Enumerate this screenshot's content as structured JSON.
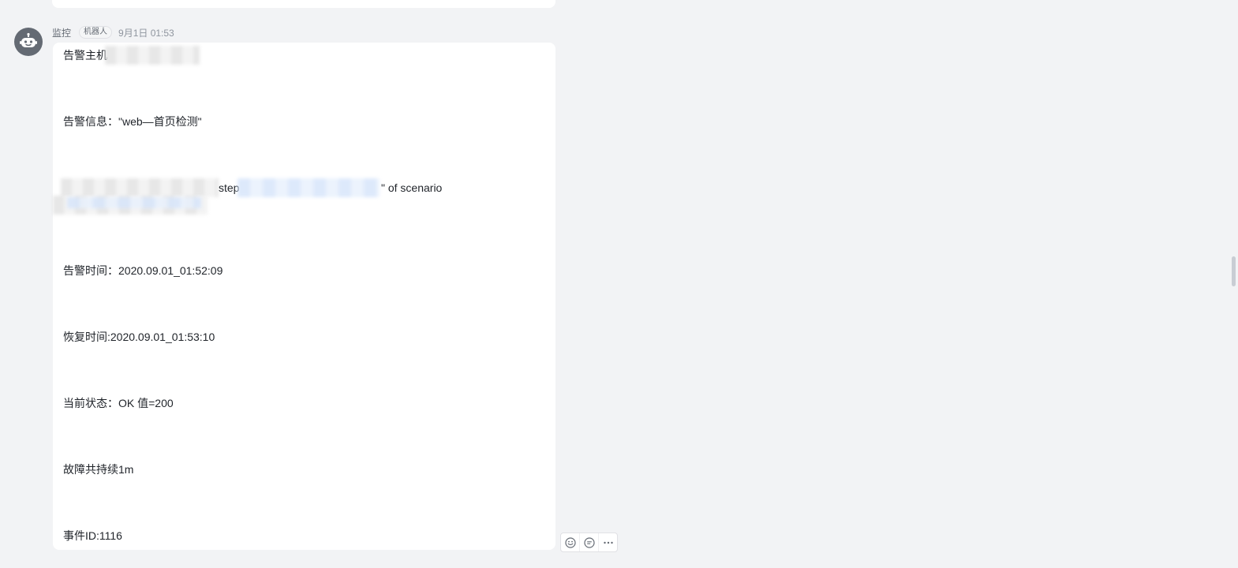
{
  "message": {
    "sender": "监控",
    "tag": "机器人",
    "time": "9月1日 01:53",
    "lines": [
      "告警主机",
      "告警信息：\"web—首页检测\"",
      "step",
      "\" of scenario",
      "告警时间：2020.09.01_01:52:09",
      "恢复时间:2020.09.01_01:53:10",
      "当前状态：OK 值=200",
      "故障共持续1m",
      "事件ID:1116"
    ]
  },
  "colors": {
    "avatar": "#646a73",
    "background": "#f2f3f5",
    "bubble": "#ffffff"
  },
  "icons": {
    "avatar": "robot-icon",
    "reaction": "emoji-icon",
    "reply": "reply-icon",
    "more": "more-icon"
  }
}
